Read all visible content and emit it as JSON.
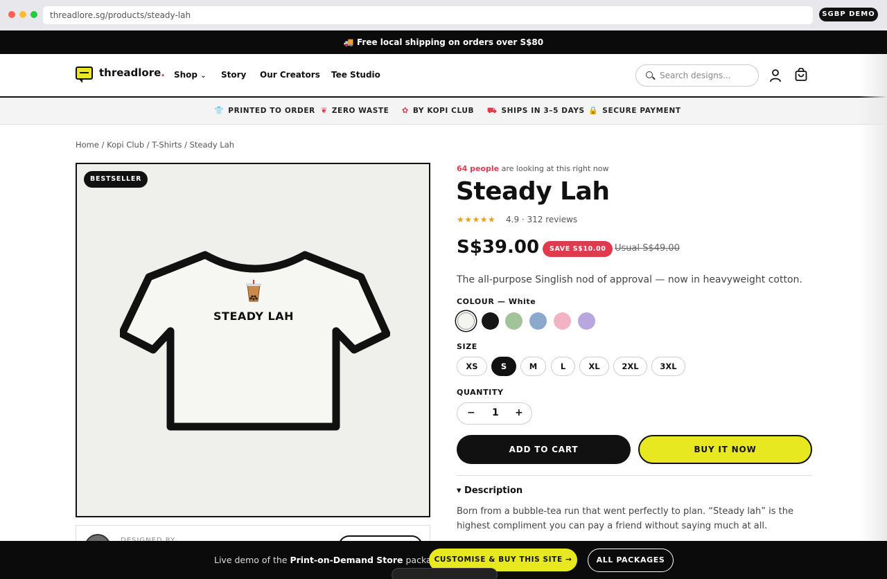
{
  "browser": {
    "url": "threadlore.sg/products/steady-lah",
    "demo_badge": "SGBP DEMO"
  },
  "promo": {
    "text": "🚚 Free local shipping on orders over S$80"
  },
  "header": {
    "logo": "threadlore",
    "logo_dot": ".",
    "nav": [
      "Shop",
      "Story",
      "Our Creators",
      "Tee Studio"
    ],
    "shop_chevron": "⌄",
    "search_placeholder": "Search designs..."
  },
  "features": [
    {
      "icon": "tshirt-icon",
      "label": "PRINTED TO ORDER"
    },
    {
      "icon": "leaf-icon",
      "label": "ZERO WASTE"
    },
    {
      "icon": "palette-icon",
      "label": "BY KOPI CLUB"
    },
    {
      "icon": "truck-icon",
      "label": "SHIPS IN 3–5 DAYS"
    },
    {
      "icon": "lock-icon",
      "label": "SECURE PAYMENT"
    }
  ],
  "breadcrumb": "Home / Kopi Club / T-Shirts / Steady Lah",
  "gallery": {
    "badge": "BESTSELLER",
    "print_text": "STEADY LAH"
  },
  "designer": {
    "label": "DESIGNED BY"
  },
  "product": {
    "viewers_count": "64 people",
    "viewers_rest": " are looking at this right now",
    "title": "Steady Lah",
    "stars": "★★★★★",
    "rating": "4.9 · 312 reviews",
    "price": "S$39.00",
    "save": "SAVE S$10.00",
    "usual": "Usual S$49.00",
    "tagline": "The all-purpose Singlish nod of approval — now in heavyweight cotton.",
    "colour_label": "COLOUR — White",
    "colours": [
      "#f5f5f0",
      "#161616",
      "#a3c49a",
      "#8aa9cc",
      "#f2b3c4",
      "#b9a6df"
    ],
    "size_label": "SIZE",
    "sizes": [
      "XS",
      "S",
      "M",
      "L",
      "XL",
      "2XL",
      "3XL"
    ],
    "selected_size": "S",
    "quantity_label": "QUANTITY",
    "quantity": "1",
    "minus": "−",
    "plus": "+",
    "add_to_cart": "ADD TO CART",
    "buy_now": "BUY IT NOW",
    "description_heading": "▾ Description",
    "description": "Born from a bubble-tea run that went perfectly to plan. “Steady lah” is the highest compliment you can pay a friend without saying much at all."
  },
  "demo_bar": {
    "text_pre": "Live demo of the ",
    "text_bold": "Print-on-Demand Store",
    "text_post": " package.",
    "cta": "CUSTOMISE & BUY THIS SITE →",
    "packages": "ALL PACKAGES"
  },
  "colors": {
    "accent_yellow": "#e8e820",
    "accent_red": "#e03a4e",
    "dark": "#111111"
  }
}
